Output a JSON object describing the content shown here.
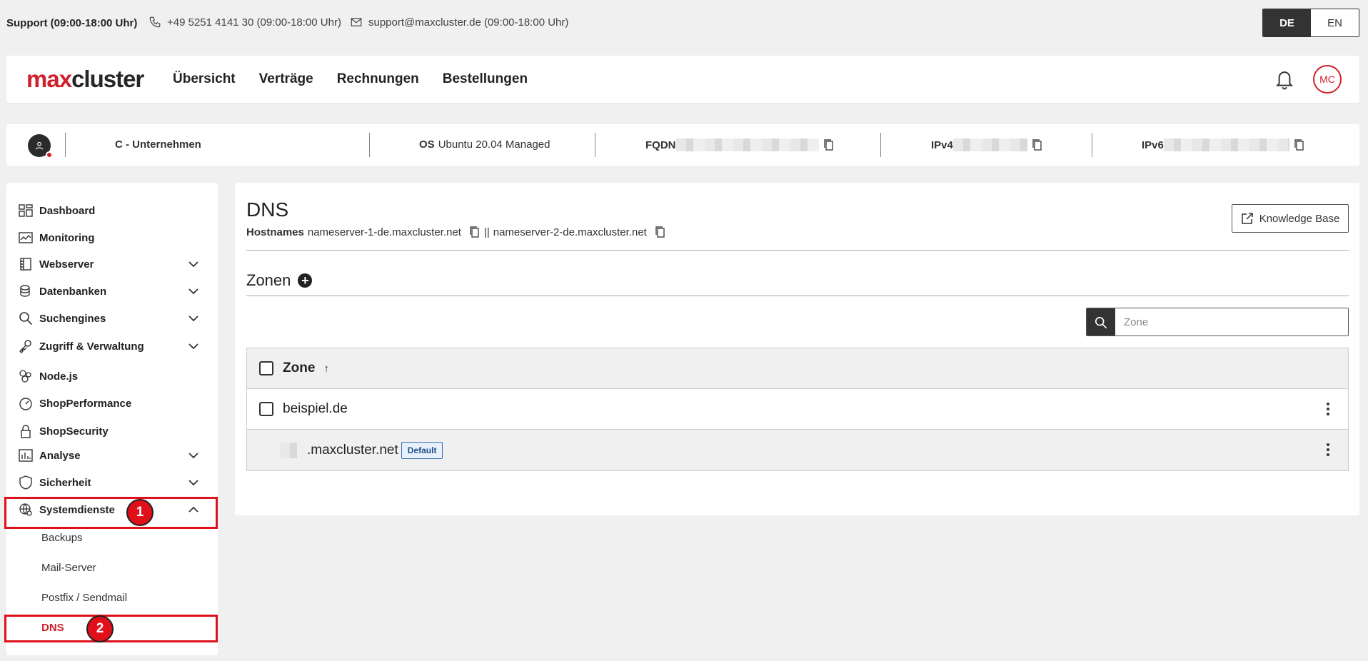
{
  "topbar": {
    "support_label": "Support (09:00-18:00 Uhr)",
    "phone": "+49 5251 4141 30 (09:00-18:00 Uhr)",
    "email": "support@maxcluster.de (09:00-18:00 Uhr)",
    "lang_de": "DE",
    "lang_en": "EN"
  },
  "navbar": {
    "logo_max": "max",
    "logo_cluster": "cluster",
    "links": [
      "Übersicht",
      "Verträge",
      "Rechnungen",
      "Bestellungen"
    ],
    "avatar_initials": "MC"
  },
  "infostrip": {
    "company": "C        - Unternehmen",
    "os_label": "OS",
    "os_value": "Ubuntu 20.04 Managed",
    "fqdn_label": "FQDN",
    "ipv4_label": "IPv4",
    "ipv6_label": "IPv6"
  },
  "sidebar": {
    "items": [
      {
        "label": "Dashboard",
        "icon": "dashboard-icon"
      },
      {
        "label": "Monitoring",
        "icon": "monitoring-icon"
      },
      {
        "label": "Webserver",
        "icon": "webserver-icon"
      },
      {
        "label": "Datenbanken",
        "icon": "database-icon"
      },
      {
        "label": "Suchengines",
        "icon": "search-icon"
      },
      {
        "label": "Zugriff & Verwaltung",
        "icon": "key-icon"
      },
      {
        "label": "Node.js",
        "icon": "nodejs-icon"
      },
      {
        "label": "ShopPerformance",
        "icon": "speedometer-icon"
      },
      {
        "label": "ShopSecurity",
        "icon": "lock-icon"
      },
      {
        "label": "Analyse",
        "icon": "analytics-icon"
      },
      {
        "label": "Sicherheit",
        "icon": "shield-icon"
      },
      {
        "label": "Systemdienste",
        "icon": "globe-gear-icon"
      }
    ],
    "sub_items": [
      "Backups",
      "Mail-Server",
      "Postfix / Sendmail",
      "DNS"
    ],
    "annotation_1": "1",
    "annotation_2": "2"
  },
  "main": {
    "title": "DNS",
    "hostnames_label": "Hostnames",
    "hostname_1": "nameserver-1-de.maxcluster.net",
    "separator": "||",
    "hostname_2": "nameserver-2-de.maxcluster.net",
    "kb_button": "Knowledge Base",
    "zonen_title": "Zonen",
    "search_placeholder": "Zone",
    "table": {
      "header": "Zone",
      "rows": [
        {
          "label": "beispiel.de"
        },
        {
          "label": ".maxcluster.net",
          "badge": "Default"
        }
      ]
    }
  }
}
